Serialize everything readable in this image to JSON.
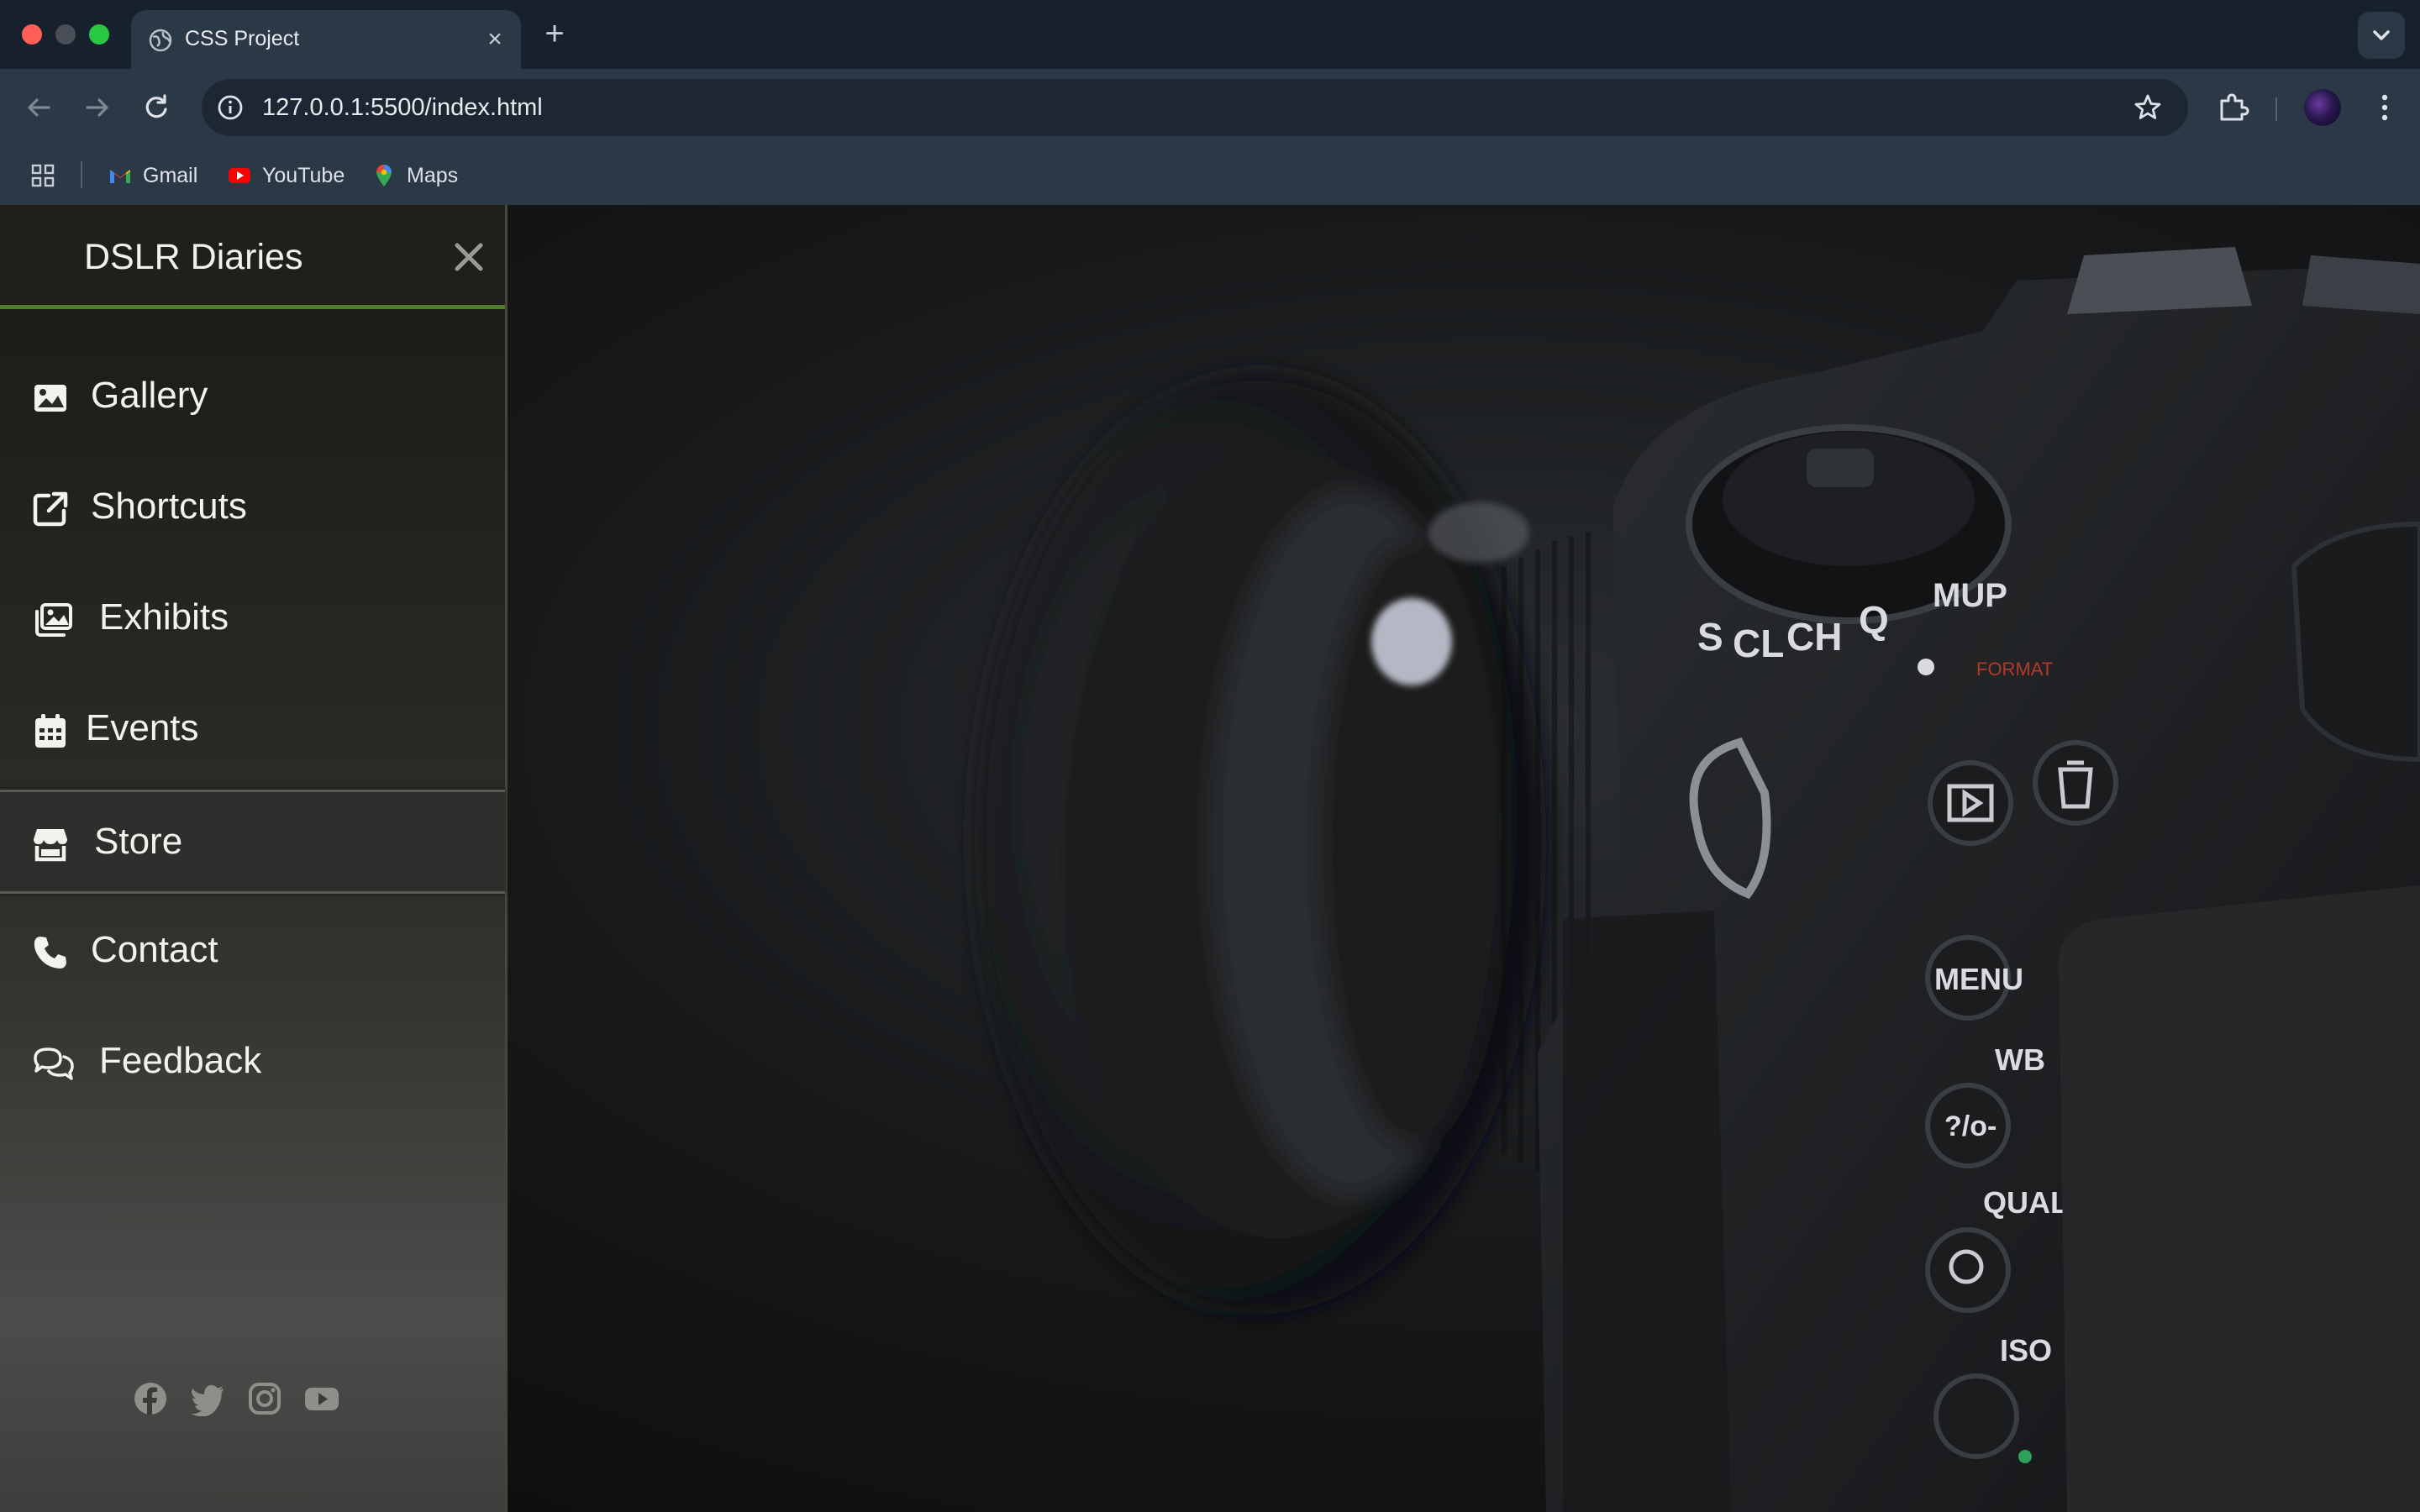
{
  "browser": {
    "tab_title": "CSS Project",
    "tab_close": "×",
    "new_tab": "+",
    "url": "127.0.0.1:5500/index.html",
    "bookmarks": [
      {
        "label": "Gmail",
        "icon": "gmail-icon"
      },
      {
        "label": "YouTube",
        "icon": "youtube-icon"
      },
      {
        "label": "Maps",
        "icon": "maps-icon"
      }
    ]
  },
  "sidebar": {
    "title": "DSLR Diaries",
    "items": [
      {
        "label": "Gallery",
        "icon": "image-icon"
      },
      {
        "label": "Shortcuts",
        "icon": "external-link-icon"
      },
      {
        "label": "Exhibits",
        "icon": "images-icon"
      },
      {
        "label": "Events",
        "icon": "calendar-icon"
      },
      {
        "label": "Store",
        "icon": "store-icon",
        "active": true
      },
      {
        "label": "Contact",
        "icon": "phone-icon"
      },
      {
        "label": "Feedback",
        "icon": "comments-icon"
      }
    ],
    "socials": [
      "facebook-icon",
      "twitter-icon",
      "instagram-icon",
      "youtube-icon"
    ]
  },
  "hero": {
    "camera_dial_labels": [
      "S",
      "CL",
      "CH",
      "Q",
      "MUP"
    ],
    "camera_button_labels": [
      "MENU",
      "WB",
      "QUAL",
      "ISO",
      "FORMAT"
    ]
  },
  "colors": {
    "accent_green": "#4d7c2b",
    "sidebar_text": "#f2f2ef",
    "chrome_bg": "#2b3846"
  }
}
